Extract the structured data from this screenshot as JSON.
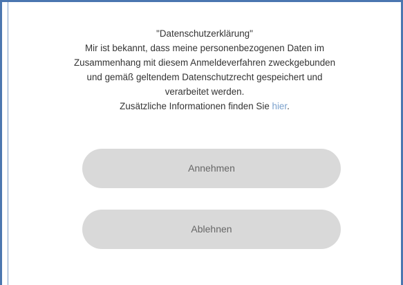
{
  "dialog": {
    "title": "\"Datenschutzerklärung\"",
    "lines": [
      "Mir ist bekannt, dass meine personenbezogenen Daten im",
      "Zusammenhang mit diesem Anmeldeverfahren zweckgebunden",
      "und gemäß geltendem Datenschutzrecht gespeichert und",
      "verarbeitet werden."
    ],
    "info_prefix": "Zusätzliche Informationen finden Sie ",
    "info_link": "hier",
    "info_suffix": ".",
    "accept_label": "Annehmen",
    "decline_label": "Ablehnen"
  },
  "colors": {
    "border": "#4a76b0",
    "link": "#7aa0cc",
    "button_bg": "#d9d9d9",
    "button_text": "#666666"
  }
}
